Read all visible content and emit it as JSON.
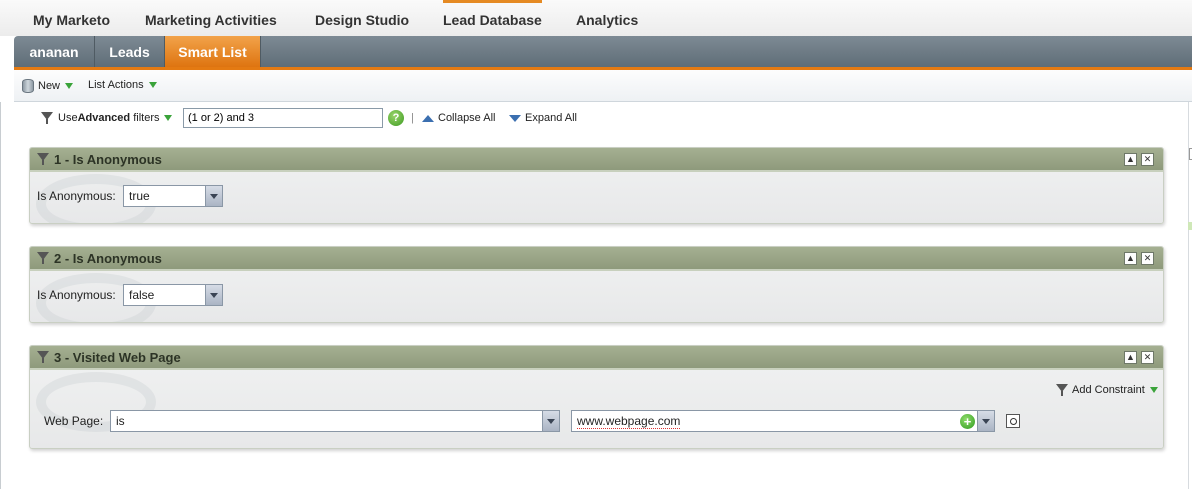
{
  "topnav": {
    "items": [
      {
        "label": "My Marketo",
        "active": false
      },
      {
        "label": "Marketing Activities",
        "active": false
      },
      {
        "label": "Design Studio",
        "active": false
      },
      {
        "label": "Lead Database",
        "active": true
      },
      {
        "label": "Analytics",
        "active": false
      }
    ]
  },
  "subtabs": [
    {
      "label": "ananan",
      "active": false
    },
    {
      "label": "Leads",
      "active": false
    },
    {
      "label": "Smart List",
      "active": true
    }
  ],
  "toolbar": {
    "new_label": "New",
    "list_actions_label": "List Actions"
  },
  "logic": {
    "prefix": "Use ",
    "bold": "Advanced",
    "suffix": " filters",
    "value": "(1 or 2) and 3",
    "help_glyph": "?",
    "collapse_all": "Collapse All",
    "expand_all": "Expand All"
  },
  "filters": [
    {
      "title": "1 - Is Anonymous",
      "field_label": "Is Anonymous:",
      "value": "true"
    },
    {
      "title": "2 - Is Anonymous",
      "field_label": "Is Anonymous:",
      "value": "false"
    },
    {
      "title": "3 - Visited Web Page",
      "field_label": "Web Page:",
      "operator": "is",
      "value": "www.webpage.com",
      "add_constraint": "Add Constraint"
    }
  ],
  "icons": {
    "minimize": "▲",
    "close": "✕",
    "add": "+"
  },
  "colors": {
    "accent": "#e58a23",
    "panel_header": "#97a385",
    "subbar": "#6e7b85"
  }
}
